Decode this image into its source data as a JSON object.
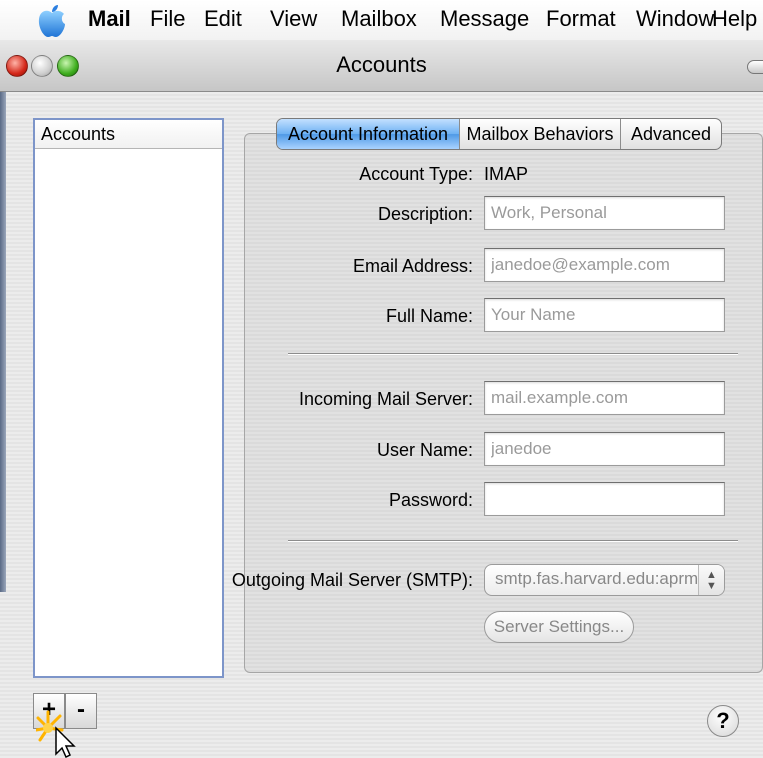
{
  "menubar": {
    "app": "Mail",
    "items": [
      "File",
      "Edit",
      "View",
      "Mailbox",
      "Message",
      "Format",
      "Window",
      "Help"
    ]
  },
  "window": {
    "title": "Accounts"
  },
  "sidebar": {
    "header": "Accounts",
    "add_label": "+",
    "remove_label": "-"
  },
  "tabs": [
    "Account Information",
    "Mailbox Behaviors",
    "Advanced"
  ],
  "form": {
    "account_type_label": "Account Type:",
    "account_type_value": "IMAP",
    "description_label": "Description:",
    "description_placeholder": "Work, Personal",
    "email_label": "Email Address:",
    "email_placeholder": "janedoe@example.com",
    "fullname_label": "Full Name:",
    "fullname_placeholder": "Your Name",
    "incoming_label": "Incoming Mail Server:",
    "incoming_placeholder": "mail.example.com",
    "username_label": "User Name:",
    "username_placeholder": "janedoe",
    "password_label": "Password:",
    "password_value": "",
    "smtp_label": "Outgoing Mail Server (SMTP):",
    "smtp_value": "smtp.fas.harvard.edu:aprm",
    "server_settings_label": "Server Settings..."
  },
  "help_label": "?",
  "colors": {
    "active_tab": "#5ea6ee",
    "list_border": "#7d95c9",
    "close": "#d4281a",
    "zoom": "#3fae1f"
  }
}
